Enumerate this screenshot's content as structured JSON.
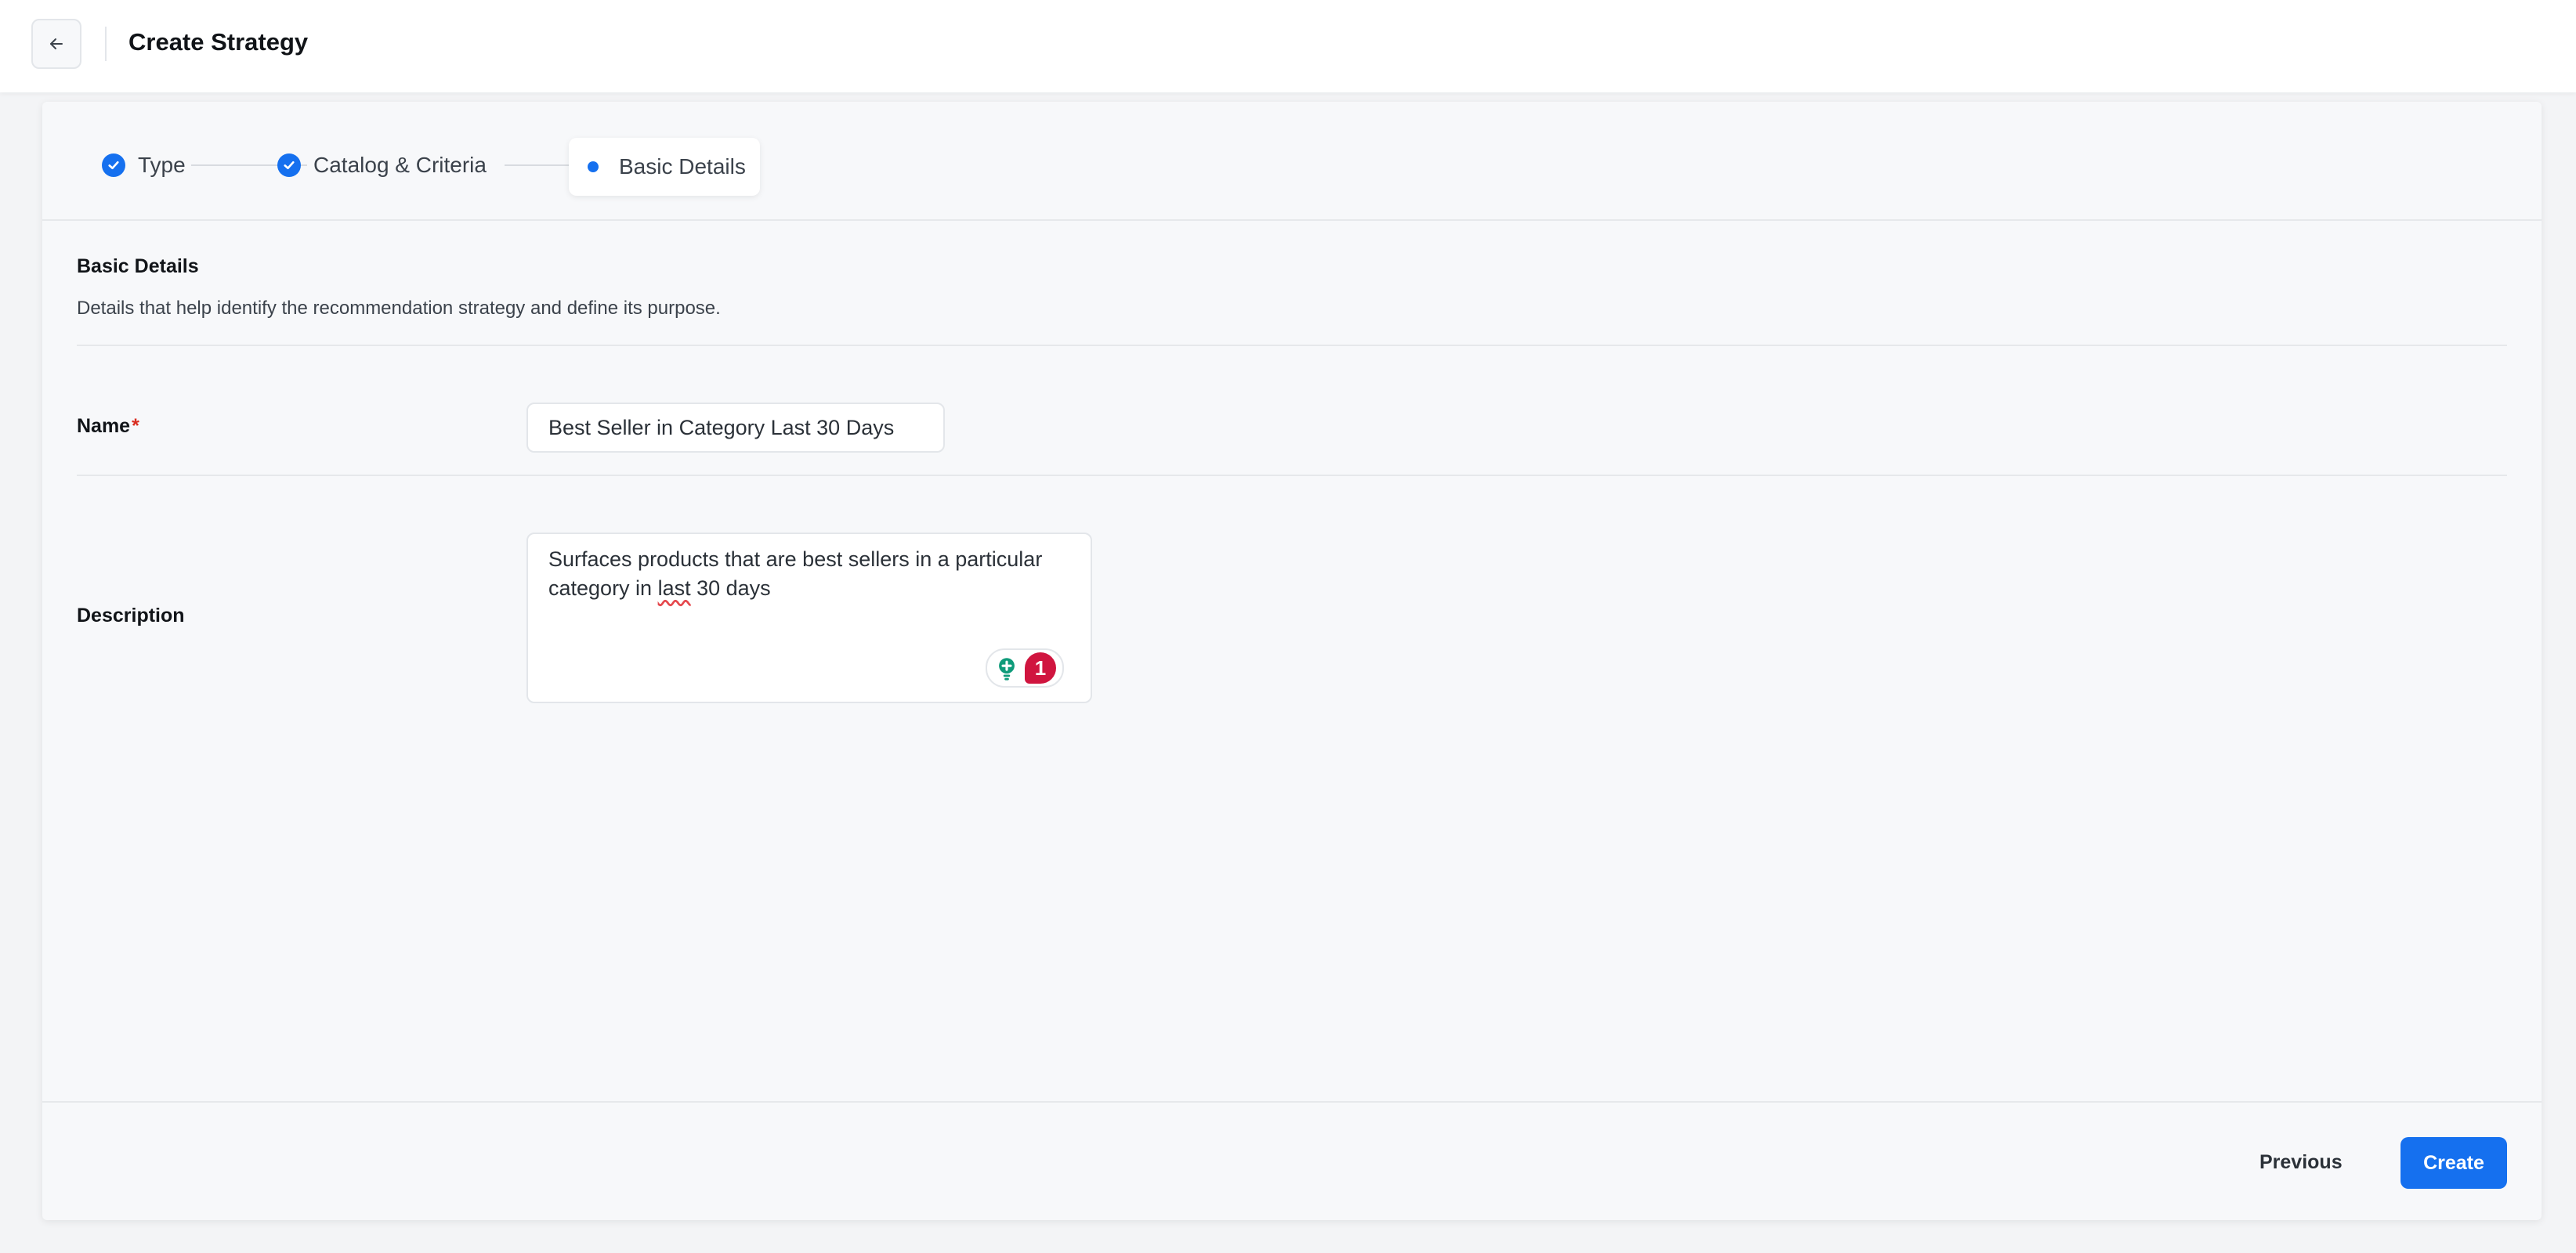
{
  "header": {
    "title": "Create Strategy",
    "back_icon": "arrow-left-icon"
  },
  "stepper": {
    "steps": [
      {
        "label": "Type",
        "status": "completed",
        "icon": "check-circle-icon"
      },
      {
        "label": "Catalog & Criteria",
        "status": "completed",
        "icon": "check-circle-icon"
      },
      {
        "label": "Basic Details",
        "status": "current",
        "icon": "dot-icon"
      }
    ]
  },
  "section": {
    "title": "Basic Details",
    "description": "Details that help identify the recommendation strategy and define its purpose."
  },
  "form": {
    "name": {
      "label": "Name",
      "required_marker": "*",
      "value": "Best Seller in Category Last 30 Days"
    },
    "description": {
      "label": "Description",
      "value_before": "Surfaces products that are best sellers in a particular\ncategory in ",
      "value_flagged": "last",
      "value_after": " 30 days",
      "grammar_widget": {
        "icon": "lightbulb-plus-icon",
        "issue_count": "1"
      }
    }
  },
  "footer": {
    "previous_label": "Previous",
    "create_label": "Create"
  },
  "colors": {
    "accent": "#1570ef",
    "required": "#d92d20",
    "issue_badge": "#d0153f",
    "grammar_icon": "#0f9b7a"
  }
}
